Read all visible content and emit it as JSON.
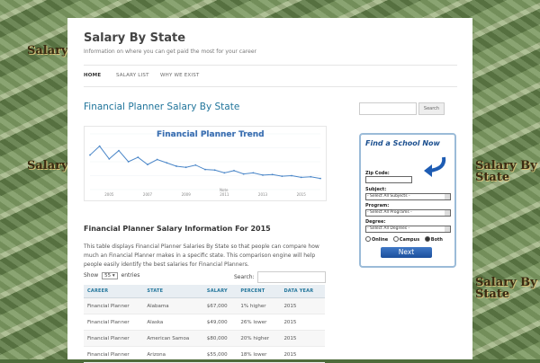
{
  "site": {
    "title": "Salary By State",
    "description": "Information on where you can get paid the most for your career"
  },
  "nav": {
    "items": [
      "HOME",
      "SALARY LIST",
      "WHY WE EXIST"
    ]
  },
  "background_tags": [
    "Salary By State",
    "Salary By State",
    "Salary By State",
    "Salary By State"
  ],
  "page_title": "Financial Planner Salary By State",
  "trend_chart": {
    "title": "Financial Planner Trend",
    "x_ticks": [
      "2005",
      "2007",
      "2009",
      "2011",
      "2013",
      "2015"
    ],
    "x_axis_note": "Note"
  },
  "chart_data": {
    "type": "line",
    "title": "Financial Planner Trend",
    "x": [
      2004,
      2004.5,
      2005,
      2005.5,
      2006,
      2006.5,
      2007,
      2007.5,
      2008,
      2008.5,
      2009,
      2009.5,
      2010,
      2010.5,
      2011,
      2011.5,
      2012,
      2012.5,
      2013,
      2013.5,
      2014,
      2014.5,
      2015,
      2015.5,
      2016
    ],
    "series": [
      {
        "values": [
          62,
          78,
          55,
          70,
          50,
          58,
          45,
          54,
          48,
          42,
          40,
          44,
          36,
          35,
          30,
          34,
          28,
          30,
          26,
          27,
          24,
          25,
          22,
          23,
          20
        ]
      }
    ],
    "ylim": [
      0,
      100
    ],
    "grid": true
  },
  "section_heading": "Financial Planner Salary Information For 2015",
  "intro_text": "This table displays Financial Planner Salaries By State so that people can compare how much an Financial Planner makes in a specific state. This comparison engine will help people easily identify the best salaries for Financial Planners.",
  "table_controls": {
    "show_label": "Show",
    "entries_value": "55",
    "entries_label": "entries",
    "search_label": "Search:"
  },
  "table": {
    "columns": [
      "CAREER",
      "STATE",
      "SALARY",
      "PERCENT",
      "DATA YEAR"
    ],
    "rows": [
      [
        "Financial Planner",
        "Alabama",
        "$67,000",
        "1% higher",
        "2015"
      ],
      [
        "Financial Planner",
        "Alaska",
        "$49,000",
        "26% lower",
        "2015"
      ],
      [
        "Financial Planner",
        "American Samoa",
        "$80,000",
        "20% higher",
        "2015"
      ],
      [
        "Financial Planner",
        "Arizona",
        "$55,000",
        "18% lower",
        "2015"
      ]
    ]
  },
  "sidebar": {
    "search_button": "Search",
    "school_widget": {
      "title": "Find a School Now",
      "zip_label": "Zip Code:",
      "subject_label": "Subject:",
      "subject_value": "- Select All Subjects -",
      "program_label": "Program:",
      "program_value": "- Select All Programs -",
      "degree_label": "Degree:",
      "degree_value": "- Select All Degrees -",
      "radio_options": [
        "Online",
        "Campus",
        "Both"
      ],
      "selected_radio": "Both",
      "next_button": "Next"
    }
  }
}
